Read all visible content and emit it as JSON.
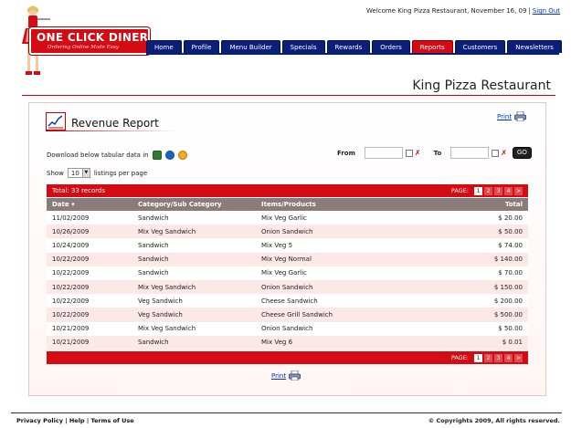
{
  "header": {
    "welcome": "Welcome King Pizza Restaurant, November 16, 09",
    "sign_out": "Sign Out"
  },
  "logo": {
    "title": "ONE CLICK DINER",
    "tagline": "Ordering Online Made Easy"
  },
  "nav": {
    "tabs": [
      "Home",
      "Profile",
      "Menu Builder",
      "Specials",
      "Rewards",
      "Orders",
      "Reports",
      "Customers",
      "Newsletters"
    ],
    "active": "Reports"
  },
  "page": {
    "restaurant_name": "King Pizza Restaurant"
  },
  "report": {
    "title": "Revenue Report",
    "print": "Print",
    "download_label": "Download below tabular data in",
    "from_label": "From",
    "to_label": "To",
    "from_value": "",
    "to_value": "",
    "go": "GO",
    "show_label": "Show",
    "per_page": "10",
    "listings_label": "listings per page",
    "total": "Total: 33 records",
    "page_label": "PAGE:",
    "pages": [
      "1",
      "2",
      "3",
      "4",
      ">"
    ],
    "current_page": "1",
    "columns": [
      "Date ▾",
      "Category/Sub Category",
      "Items/Products",
      "Total"
    ],
    "rows": [
      [
        "11/02/2009",
        "Sandwich",
        "Mix Veg Garlic",
        "$ 20.00"
      ],
      [
        "10/26/2009",
        "Mix Veg Sandwich",
        "Onion Sandwich",
        "$ 50.00"
      ],
      [
        "10/24/2009",
        "Sandwich",
        "Mix Veg 5",
        "$ 74.00"
      ],
      [
        "10/22/2009",
        "Sandwich",
        "Mix Veg Normal",
        "$ 140.00"
      ],
      [
        "10/22/2009",
        "Sandwich",
        "Mix Veg Garlic",
        "$ 70.00"
      ],
      [
        "10/22/2009",
        "Mix Veg Sandwich",
        "Onion Sandwich",
        "$ 150.00"
      ],
      [
        "10/22/2009",
        "Veg Sandwich",
        "Cheese Sandwich",
        "$ 200.00"
      ],
      [
        "10/22/2009",
        "Veg Sandwich",
        "Cheese Grill Sandwich",
        "$ 500.00"
      ],
      [
        "10/21/2009",
        "Mix Veg Sandwich",
        "Onion Sandwich",
        "$ 50.00"
      ],
      [
        "10/21/2009",
        "Sandwich",
        "Mix Veg 6",
        "$ 0.01"
      ]
    ]
  },
  "footer": {
    "privacy": "Privacy Policy",
    "help": "Help",
    "terms": "Terms of Use",
    "copyright": "© Copyrights 2009, All rights reserved."
  },
  "colors": {
    "brand_red": "#d40b12",
    "nav_blue": "#0a1f78"
  }
}
